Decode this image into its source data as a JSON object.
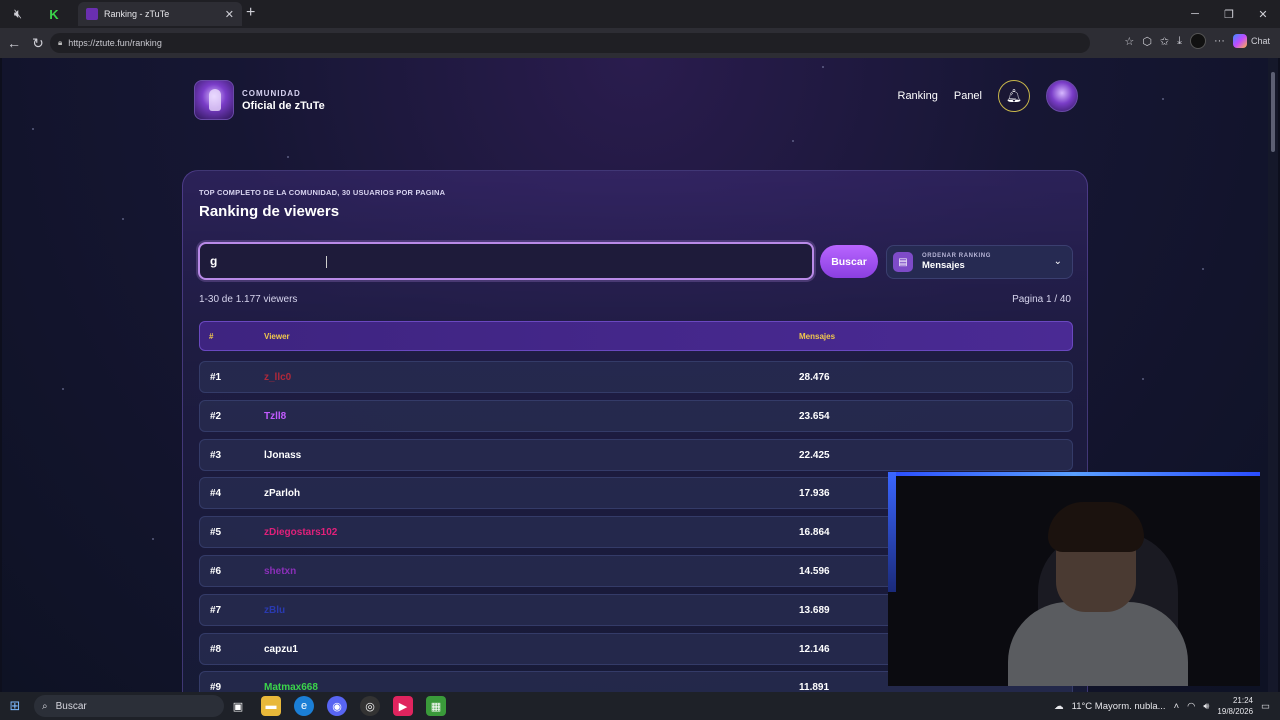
{
  "browser": {
    "tab_title": "Ranking - zTuTe",
    "tab_close": "✕",
    "new_tab": "+",
    "url": "https://ztute.fun/ranking",
    "chat_label": "Chat"
  },
  "header": {
    "brand_top": "COMUNIDAD",
    "brand_main": "Oficial de zTuTe",
    "nav": [
      "Ranking",
      "Panel"
    ]
  },
  "card": {
    "kicker": "TOP COMPLETO DE LA COMUNIDAD, 30 USUARIOS POR PAGINA",
    "title": "Ranking de viewers",
    "search_value": "g",
    "search_button": "Buscar",
    "order_label": "ORDENAR RANKING",
    "order_value": "Mensajes",
    "count_text": "1-30 de 1.177 viewers",
    "page_text": "Pagina 1 / 40"
  },
  "table": {
    "headers": [
      "#",
      "Viewer",
      "Mensajes"
    ],
    "rows": [
      {
        "rank": "#1",
        "viewer": "z_llc0",
        "messages": "28.476",
        "color": "#b0283a"
      },
      {
        "rank": "#2",
        "viewer": "Tzll8",
        "messages": "23.654",
        "color": "#c25bff"
      },
      {
        "rank": "#3",
        "viewer": "lJonass",
        "messages": "22.425",
        "color": "#ffffff"
      },
      {
        "rank": "#4",
        "viewer": "zParloh",
        "messages": "17.936",
        "color": "#ffffff"
      },
      {
        "rank": "#5",
        "viewer": "zDiegostars102",
        "messages": "16.864",
        "color": "#e0207a"
      },
      {
        "rank": "#6",
        "viewer": "shetxn",
        "messages": "14.596",
        "color": "#8a2fb8"
      },
      {
        "rank": "#7",
        "viewer": "zBlu",
        "messages": "13.689",
        "color": "#2a3ab0"
      },
      {
        "rank": "#8",
        "viewer": "capzu1",
        "messages": "12.146",
        "color": "#ffffff"
      },
      {
        "rank": "#9",
        "viewer": "Matmax668",
        "messages": "11.891",
        "color": "#3bd44a"
      }
    ]
  },
  "taskbar": {
    "search_label": "Buscar",
    "weather": "11°C  Mayorm. nubla...",
    "time": "21:24",
    "date": "19/8/2026"
  }
}
